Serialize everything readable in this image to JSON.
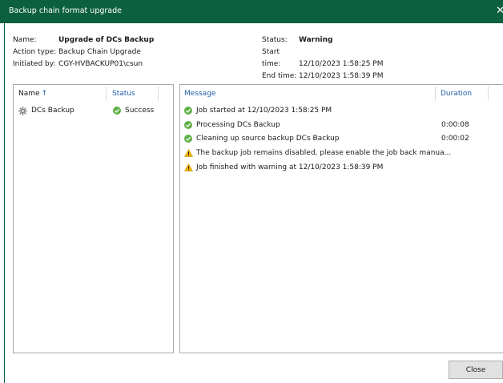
{
  "window": {
    "title": "Backup chain format upgrade"
  },
  "summary": {
    "name_label": "Name:",
    "name_value": "Upgrade of DCs Backup",
    "action_label": "Action type:",
    "action_value": "Backup Chain Upgrade",
    "initiated_label": "Initiated by:",
    "initiated_value": "CGY-HVBACKUP01\\csun",
    "status_label": "Status:",
    "status_value": "Warning",
    "start_label": "Start time:",
    "start_value": "12/10/2023 1:58:25 PM",
    "end_label": "End time:",
    "end_value": "12/10/2023 1:58:39 PM"
  },
  "objects": {
    "columns": {
      "name": "Name",
      "sort_arrow": "↑",
      "status": "Status"
    },
    "rows": [
      {
        "name": "DCs Backup",
        "status": "Success",
        "icon": "gear-icon",
        "status_icon": "check-circle-icon"
      }
    ]
  },
  "log": {
    "columns": {
      "message": "Message",
      "duration": "Duration"
    },
    "rows": [
      {
        "message": "Job started at 12/10/2023 1:58:25 PM",
        "duration": "",
        "icon": "check-circle-icon"
      },
      {
        "message": "Processing DCs Backup",
        "duration": "0:00:08",
        "icon": "check-circle-icon"
      },
      {
        "message": "Cleaning up source backup DCs Backup",
        "duration": "0:00:02",
        "icon": "check-circle-icon"
      },
      {
        "message": "The backup job remains disabled, please enable the job back manua...",
        "duration": "",
        "icon": "warning-icon"
      },
      {
        "message": "Job finished with warning at 12/10/2023 1:58:39 PM",
        "duration": "",
        "icon": "warning-icon"
      }
    ]
  },
  "buttons": {
    "close": "Close"
  },
  "colors": {
    "titlebar": "#0c6040",
    "success": "#62b046",
    "warning": "#f2b400",
    "header_link": "#1f5fa8"
  }
}
